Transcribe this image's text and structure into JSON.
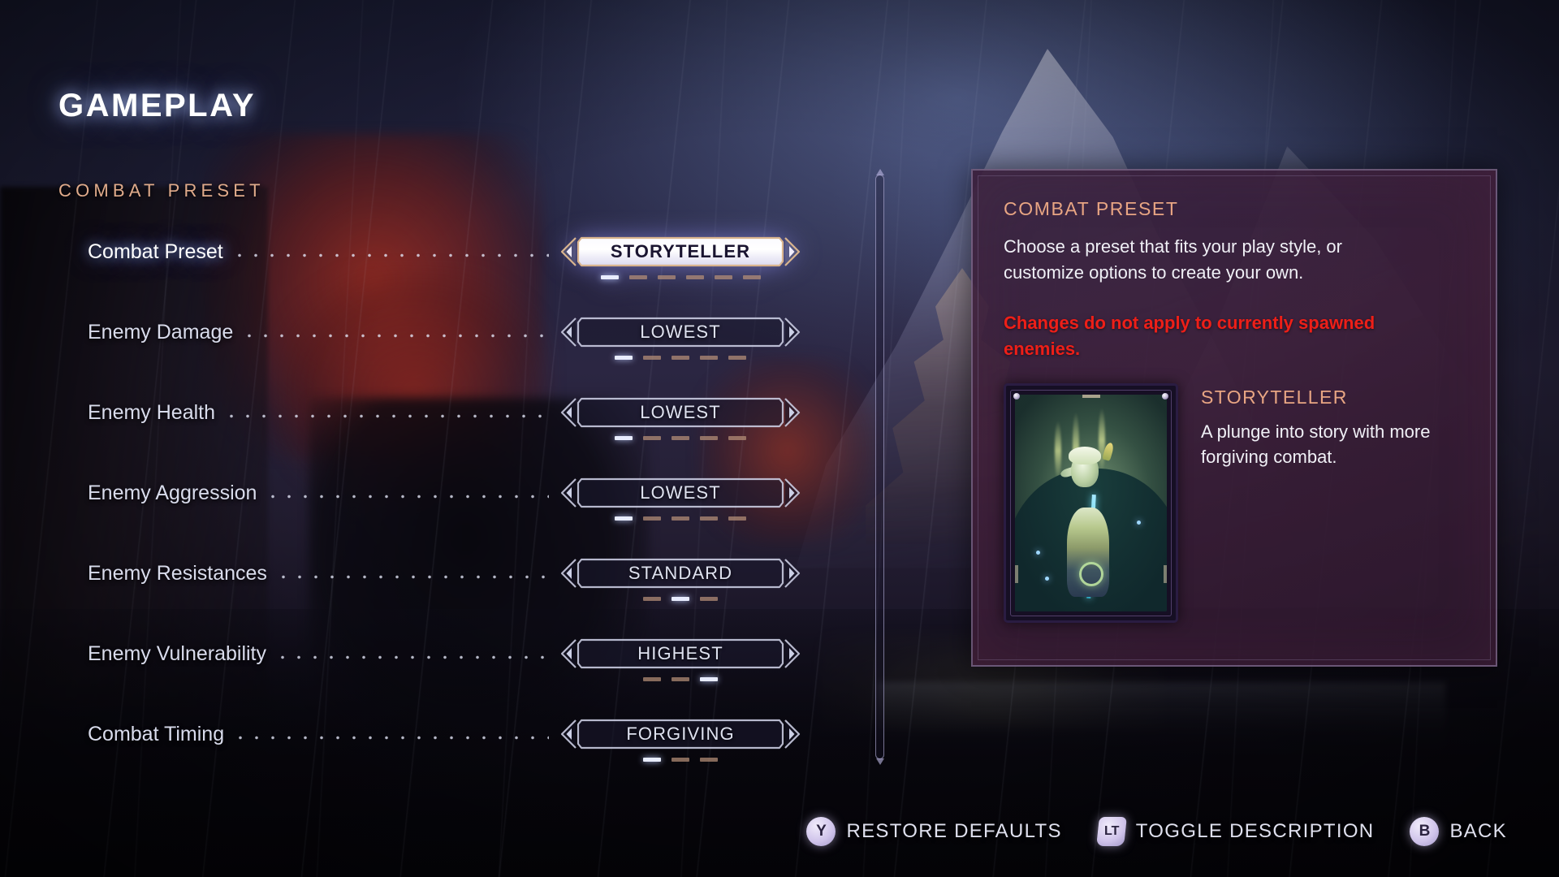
{
  "header": {
    "title": "GAMEPLAY",
    "section": "COMBAT PRESET"
  },
  "settings": [
    {
      "label": "Combat Preset",
      "value": "STORYTELLER",
      "selected": true,
      "ticks": 6,
      "active_tick": 0
    },
    {
      "label": "Enemy Damage",
      "value": "LOWEST",
      "selected": false,
      "ticks": 5,
      "active_tick": 0
    },
    {
      "label": "Enemy Health",
      "value": "LOWEST",
      "selected": false,
      "ticks": 5,
      "active_tick": 0
    },
    {
      "label": "Enemy Aggression",
      "value": "LOWEST",
      "selected": false,
      "ticks": 5,
      "active_tick": 0
    },
    {
      "label": "Enemy Resistances",
      "value": "STANDARD",
      "selected": false,
      "ticks": 3,
      "active_tick": 1
    },
    {
      "label": "Enemy Vulnerability",
      "value": "HIGHEST",
      "selected": false,
      "ticks": 3,
      "active_tick": 2
    },
    {
      "label": "Combat Timing",
      "value": "FORGIVING",
      "selected": false,
      "ticks": 3,
      "active_tick": 0
    }
  ],
  "description": {
    "title": "COMBAT PRESET",
    "body": "Choose a preset that fits your play style, or customize options to create your own.",
    "warning": "Changes do not apply to currently spawned enemies.",
    "preset_name": "STORYTELLER",
    "preset_desc": "A plunge into story with more forgiving combat."
  },
  "footer": {
    "hints": [
      {
        "glyph": "Y",
        "type": "round",
        "label": "RESTORE DEFAULTS"
      },
      {
        "glyph": "LT",
        "type": "trigger",
        "label": "TOGGLE DESCRIPTION"
      },
      {
        "glyph": "B",
        "type": "round",
        "label": "BACK"
      }
    ]
  },
  "colors": {
    "accent_tan": "#e8a583",
    "warning_red": "#ee1f18",
    "text_light": "#dfe2f0",
    "selected_fill": "#ffffff",
    "tick_idle": "#b79079",
    "tick_active": "#e8ecff"
  }
}
